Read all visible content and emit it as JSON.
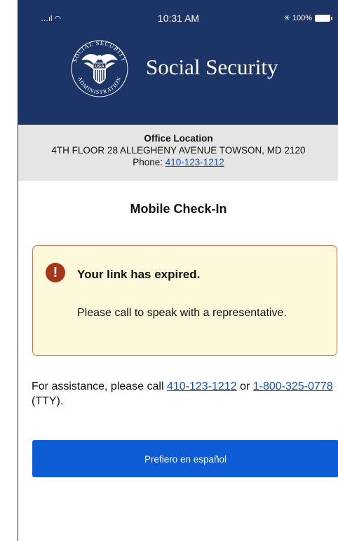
{
  "status_bar": {
    "signal": "…ıl ◠",
    "time": "10:31 AM",
    "battery": "✳ 100%"
  },
  "header": {
    "title": "Social Security",
    "seal_text_top": "SOCIAL SECURITY",
    "seal_text_bottom": "ADMINISTRATION",
    "seal_shield": "USA"
  },
  "office": {
    "heading": "Office Location",
    "address": "4TH FLOOR 28 ALLEGHENY AVENUE TOWSON, MD 2120",
    "phone_label": "Phone: ",
    "phone_number": "410-123-1212"
  },
  "main": {
    "title": "Mobile Check-In",
    "alert": {
      "icon": "!",
      "title": "Your link has expired.",
      "body": "Please call to speak with a representative."
    },
    "assistance": {
      "prefix": "For assistance, please call ",
      "phone": "410-123-1212",
      "middle": " or ",
      "tty_phone": "1-800-325-0778",
      "suffix": " (TTY)."
    },
    "spanish_button": "Prefiero en español"
  },
  "colors": {
    "header_bg": "#1d3566",
    "office_bg": "#e5e5e5",
    "alert_bg": "#fdf8d9",
    "alert_border": "#c27a54",
    "alert_icon": "#a8361a",
    "link": "#0b50d4",
    "button": "#0e5bd6"
  }
}
